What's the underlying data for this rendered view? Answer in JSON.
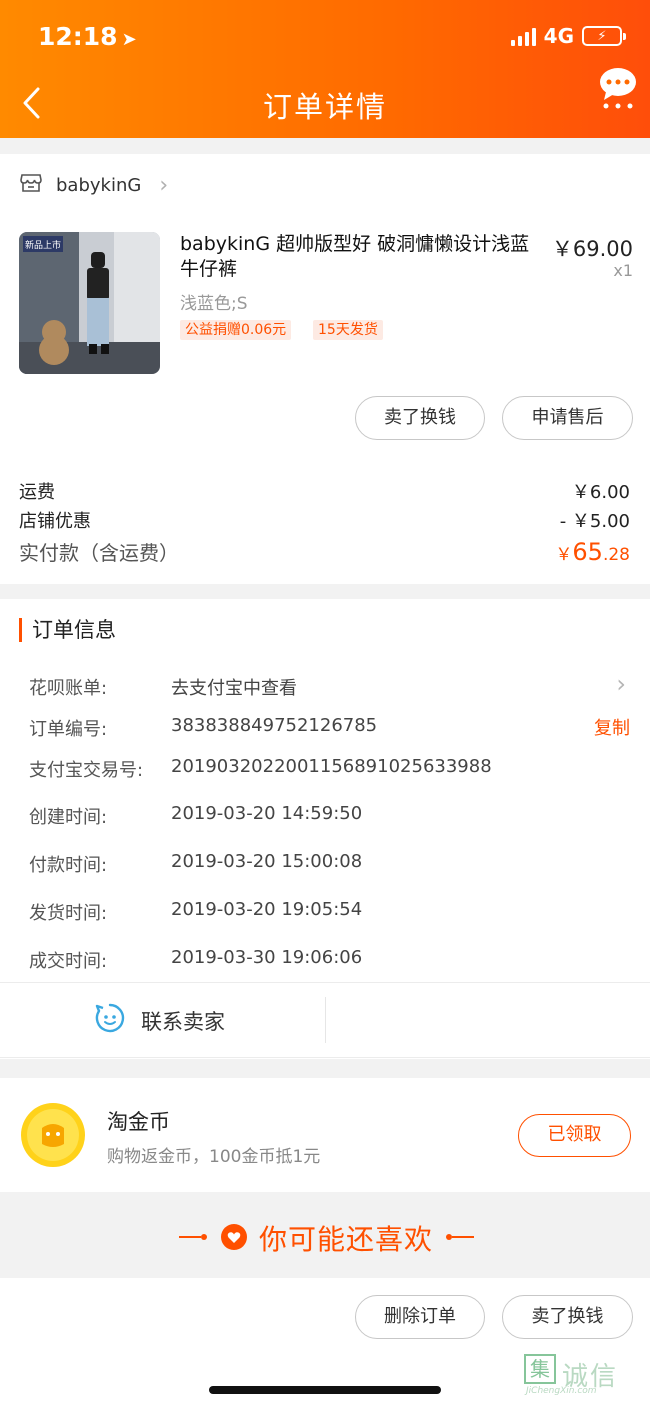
{
  "status_bar": {
    "time": "12:18",
    "network": "4G"
  },
  "header": {
    "title": "订单详情"
  },
  "shop": {
    "name": "babykinG"
  },
  "product": {
    "title": "babykinG 超帅版型好 破洞慵懒设计浅蓝牛仔裤",
    "price": "￥69.00",
    "quantity": "x1",
    "sku": "浅蓝色;S",
    "tags": [
      "公益捐赠0.06元",
      "15天发货"
    ],
    "thumb_badge": "新品上市"
  },
  "item_actions": {
    "sell_label": "卖了换钱",
    "aftersale_label": "申请售后"
  },
  "fees": {
    "shipping_label": "运费",
    "shipping_value": "￥6.00",
    "discount_label": "店铺优惠",
    "discount_value": "- ￥5.00",
    "total_label": "实付款（含运费）",
    "total_prefix": "￥",
    "total_int": "65",
    "total_dec": ".28"
  },
  "order_info": {
    "section_title": "订单信息",
    "huabei_label": "花呗账单:",
    "huabei_value": "去支付宝中查看",
    "order_no_label": "订单编号:",
    "order_no_value": "383838849752126785",
    "copy_label": "复制",
    "alipay_label": "支付宝交易号:",
    "alipay_value": "2019032022001156891025633988",
    "created_label": "创建时间:",
    "created_value": "2019-03-20 14:59:50",
    "paid_label": "付款时间:",
    "paid_value": "2019-03-20 15:00:08",
    "shipped_label": "发货时间:",
    "shipped_value": "2019-03-20 19:05:54",
    "completed_label": "成交时间:",
    "completed_value": "2019-03-30 19:06:06"
  },
  "contact": {
    "label": "联系卖家"
  },
  "coins": {
    "title": "淘金币",
    "subtitle": "购物返金币，100金币抵1元",
    "button_label": "已领取"
  },
  "recommend": {
    "text": "你可能还喜欢"
  },
  "bottom_actions": {
    "delete_label": "删除订单",
    "sell_label": "卖了换钱"
  },
  "watermark": {
    "brand": "诚信",
    "box_char": "集",
    "url": "JiChengXin.com"
  },
  "colors": {
    "accent": "#ff5000",
    "header_start": "#ff8a00",
    "header_end": "#ff4e0a"
  }
}
